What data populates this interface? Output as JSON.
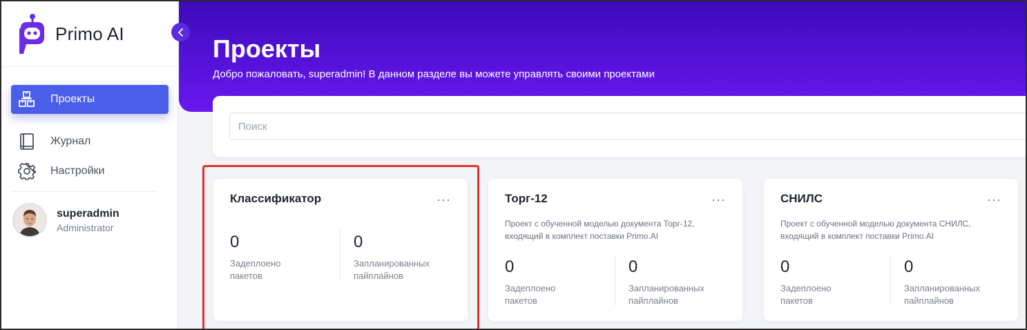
{
  "sidebar": {
    "brand": "Primo AI",
    "nav": [
      {
        "label": "Проекты",
        "icon": "projects-icon",
        "active": true
      },
      {
        "label": "Журнал",
        "icon": "journal-icon"
      },
      {
        "label": "Настройки",
        "icon": "gear-icon"
      }
    ],
    "user": {
      "name": "superadmin",
      "role": "Administrator"
    }
  },
  "hero": {
    "title": "Проекты",
    "subtitle": "Добро пожаловать, superadmin! В данном разделе вы можете управлять своими проектами"
  },
  "search": {
    "placeholder": "Поиск",
    "value": ""
  },
  "projects": [
    {
      "title": "Классификатор",
      "menu": "···",
      "description": "",
      "stats": [
        {
          "value": "0",
          "label": "Задеплоено пакетов"
        },
        {
          "value": "0",
          "label": "Запланированных пайплайнов"
        }
      ]
    },
    {
      "title": "Торг-12",
      "menu": "···",
      "description": "Проект с обученной моделью документа Торг-12, входящий в комплект поставки Primo.AI",
      "stats": [
        {
          "value": "0",
          "label": "Задеплоено пакетов"
        },
        {
          "value": "0",
          "label": "Запланированных пайплайнов"
        }
      ]
    },
    {
      "title": "СНИЛС",
      "menu": "···",
      "description": "Проект с обученной моделью документа СНИЛС, входящий в комплект поставки Primo.AI",
      "stats": [
        {
          "value": "0",
          "label": "Задеплоено пакетов"
        },
        {
          "value": "0",
          "label": "Запланированных пайплайнов"
        }
      ]
    }
  ],
  "colors": {
    "accent": "#4a5eea",
    "hero": "#5512d9",
    "highlight": "#e0332a"
  }
}
